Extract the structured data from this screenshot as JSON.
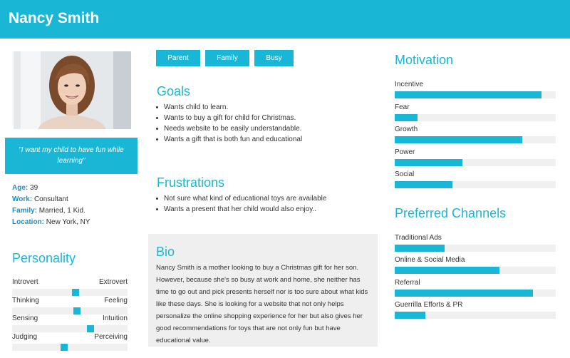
{
  "persona": {
    "name": "Nancy Smith",
    "quote": "\"I want my child to have fun while learning\"",
    "facts": [
      {
        "key": "Age:",
        "value": "39"
      },
      {
        "key": "Work:",
        "value": "Consultant"
      },
      {
        "key": "Family:",
        "value": "Married, 1 Kid."
      },
      {
        "key": "Location:",
        "value": "New York, NY"
      }
    ]
  },
  "personality": {
    "title": "Personality",
    "traits": [
      {
        "left": "Introvert",
        "right": "Extrovert",
        "level": 0.55
      },
      {
        "left": "Thinking",
        "right": "Feeling",
        "level": 0.56
      },
      {
        "left": "Sensing",
        "right": "Intuition",
        "level": 0.68
      },
      {
        "left": "Judging",
        "right": "Perceiving",
        "level": 0.45
      }
    ]
  },
  "tags": [
    "Parent",
    "Family",
    "Busy"
  ],
  "goals": {
    "title": "Goals",
    "items": [
      "Wants child to learn.",
      "Wants to buy a gift for child for Christmas.",
      "Needs website to be easily understandable.",
      "Wants a gift that is both fun and educational"
    ]
  },
  "frustrations": {
    "title": "Frustrations",
    "items": [
      "Not sure what kind of educational toys are available",
      "Wants a present that her child would also enjoy.."
    ]
  },
  "bio": {
    "title": "Bio",
    "text": "Nancy Smith is a mother looking to buy a Christmas gift for her son. However, because she's so busy at work and home, she neither has time to go out and pick presents herself nor is too sure about what kids like these days. She is looking for a website that not only helps personalize the online shopping experience for her but also gives her good recommendations for toys that are not only fun but have educational value."
  },
  "motivation": {
    "title": "Motivation",
    "items": [
      {
        "label": "Incentive",
        "level": 0.91
      },
      {
        "label": "Fear",
        "level": 0.14
      },
      {
        "label": "Growth",
        "level": 0.79
      },
      {
        "label": "Power",
        "level": 0.42
      },
      {
        "label": "Social",
        "level": 0.36
      }
    ]
  },
  "channels": {
    "title": "Preferred Channels",
    "items": [
      {
        "label": "Traditional Ads",
        "level": 0.31
      },
      {
        "label": "Online & Social Media",
        "level": 0.65
      },
      {
        "label": "Referral",
        "level": 0.86
      },
      {
        "label": "Guerrilla Efforts & PR",
        "level": 0.19
      }
    ]
  },
  "colors": {
    "accent": "#1ab6d6",
    "track": "#f0f0f0",
    "bio_bg": "#efefef"
  }
}
